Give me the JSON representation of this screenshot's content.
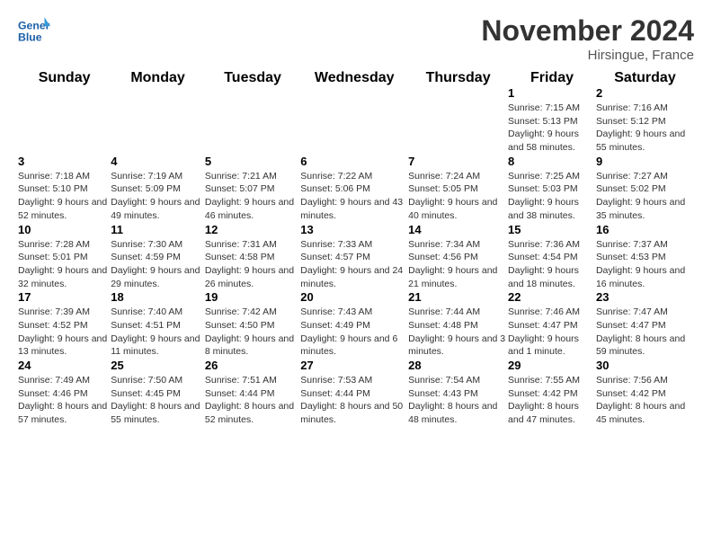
{
  "header": {
    "logo_line1": "General",
    "logo_line2": "Blue",
    "title": "November 2024",
    "location": "Hirsingue, France"
  },
  "weekdays": [
    "Sunday",
    "Monday",
    "Tuesday",
    "Wednesday",
    "Thursday",
    "Friday",
    "Saturday"
  ],
  "weeks": [
    [
      {
        "day": "",
        "empty": true
      },
      {
        "day": "",
        "empty": true
      },
      {
        "day": "",
        "empty": true
      },
      {
        "day": "",
        "empty": true
      },
      {
        "day": "",
        "empty": true
      },
      {
        "day": "1",
        "sunrise": "Sunrise: 7:15 AM",
        "sunset": "Sunset: 5:13 PM",
        "daylight": "Daylight: 9 hours and 58 minutes."
      },
      {
        "day": "2",
        "sunrise": "Sunrise: 7:16 AM",
        "sunset": "Sunset: 5:12 PM",
        "daylight": "Daylight: 9 hours and 55 minutes."
      }
    ],
    [
      {
        "day": "3",
        "sunrise": "Sunrise: 7:18 AM",
        "sunset": "Sunset: 5:10 PM",
        "daylight": "Daylight: 9 hours and 52 minutes."
      },
      {
        "day": "4",
        "sunrise": "Sunrise: 7:19 AM",
        "sunset": "Sunset: 5:09 PM",
        "daylight": "Daylight: 9 hours and 49 minutes."
      },
      {
        "day": "5",
        "sunrise": "Sunrise: 7:21 AM",
        "sunset": "Sunset: 5:07 PM",
        "daylight": "Daylight: 9 hours and 46 minutes."
      },
      {
        "day": "6",
        "sunrise": "Sunrise: 7:22 AM",
        "sunset": "Sunset: 5:06 PM",
        "daylight": "Daylight: 9 hours and 43 minutes."
      },
      {
        "day": "7",
        "sunrise": "Sunrise: 7:24 AM",
        "sunset": "Sunset: 5:05 PM",
        "daylight": "Daylight: 9 hours and 40 minutes."
      },
      {
        "day": "8",
        "sunrise": "Sunrise: 7:25 AM",
        "sunset": "Sunset: 5:03 PM",
        "daylight": "Daylight: 9 hours and 38 minutes."
      },
      {
        "day": "9",
        "sunrise": "Sunrise: 7:27 AM",
        "sunset": "Sunset: 5:02 PM",
        "daylight": "Daylight: 9 hours and 35 minutes."
      }
    ],
    [
      {
        "day": "10",
        "sunrise": "Sunrise: 7:28 AM",
        "sunset": "Sunset: 5:01 PM",
        "daylight": "Daylight: 9 hours and 32 minutes."
      },
      {
        "day": "11",
        "sunrise": "Sunrise: 7:30 AM",
        "sunset": "Sunset: 4:59 PM",
        "daylight": "Daylight: 9 hours and 29 minutes."
      },
      {
        "day": "12",
        "sunrise": "Sunrise: 7:31 AM",
        "sunset": "Sunset: 4:58 PM",
        "daylight": "Daylight: 9 hours and 26 minutes."
      },
      {
        "day": "13",
        "sunrise": "Sunrise: 7:33 AM",
        "sunset": "Sunset: 4:57 PM",
        "daylight": "Daylight: 9 hours and 24 minutes."
      },
      {
        "day": "14",
        "sunrise": "Sunrise: 7:34 AM",
        "sunset": "Sunset: 4:56 PM",
        "daylight": "Daylight: 9 hours and 21 minutes."
      },
      {
        "day": "15",
        "sunrise": "Sunrise: 7:36 AM",
        "sunset": "Sunset: 4:54 PM",
        "daylight": "Daylight: 9 hours and 18 minutes."
      },
      {
        "day": "16",
        "sunrise": "Sunrise: 7:37 AM",
        "sunset": "Sunset: 4:53 PM",
        "daylight": "Daylight: 9 hours and 16 minutes."
      }
    ],
    [
      {
        "day": "17",
        "sunrise": "Sunrise: 7:39 AM",
        "sunset": "Sunset: 4:52 PM",
        "daylight": "Daylight: 9 hours and 13 minutes."
      },
      {
        "day": "18",
        "sunrise": "Sunrise: 7:40 AM",
        "sunset": "Sunset: 4:51 PM",
        "daylight": "Daylight: 9 hours and 11 minutes."
      },
      {
        "day": "19",
        "sunrise": "Sunrise: 7:42 AM",
        "sunset": "Sunset: 4:50 PM",
        "daylight": "Daylight: 9 hours and 8 minutes."
      },
      {
        "day": "20",
        "sunrise": "Sunrise: 7:43 AM",
        "sunset": "Sunset: 4:49 PM",
        "daylight": "Daylight: 9 hours and 6 minutes."
      },
      {
        "day": "21",
        "sunrise": "Sunrise: 7:44 AM",
        "sunset": "Sunset: 4:48 PM",
        "daylight": "Daylight: 9 hours and 3 minutes."
      },
      {
        "day": "22",
        "sunrise": "Sunrise: 7:46 AM",
        "sunset": "Sunset: 4:47 PM",
        "daylight": "Daylight: 9 hours and 1 minute."
      },
      {
        "day": "23",
        "sunrise": "Sunrise: 7:47 AM",
        "sunset": "Sunset: 4:47 PM",
        "daylight": "Daylight: 8 hours and 59 minutes."
      }
    ],
    [
      {
        "day": "24",
        "sunrise": "Sunrise: 7:49 AM",
        "sunset": "Sunset: 4:46 PM",
        "daylight": "Daylight: 8 hours and 57 minutes."
      },
      {
        "day": "25",
        "sunrise": "Sunrise: 7:50 AM",
        "sunset": "Sunset: 4:45 PM",
        "daylight": "Daylight: 8 hours and 55 minutes."
      },
      {
        "day": "26",
        "sunrise": "Sunrise: 7:51 AM",
        "sunset": "Sunset: 4:44 PM",
        "daylight": "Daylight: 8 hours and 52 minutes."
      },
      {
        "day": "27",
        "sunrise": "Sunrise: 7:53 AM",
        "sunset": "Sunset: 4:44 PM",
        "daylight": "Daylight: 8 hours and 50 minutes."
      },
      {
        "day": "28",
        "sunrise": "Sunrise: 7:54 AM",
        "sunset": "Sunset: 4:43 PM",
        "daylight": "Daylight: 8 hours and 48 minutes."
      },
      {
        "day": "29",
        "sunrise": "Sunrise: 7:55 AM",
        "sunset": "Sunset: 4:42 PM",
        "daylight": "Daylight: 8 hours and 47 minutes."
      },
      {
        "day": "30",
        "sunrise": "Sunrise: 7:56 AM",
        "sunset": "Sunset: 4:42 PM",
        "daylight": "Daylight: 8 hours and 45 minutes."
      }
    ]
  ]
}
